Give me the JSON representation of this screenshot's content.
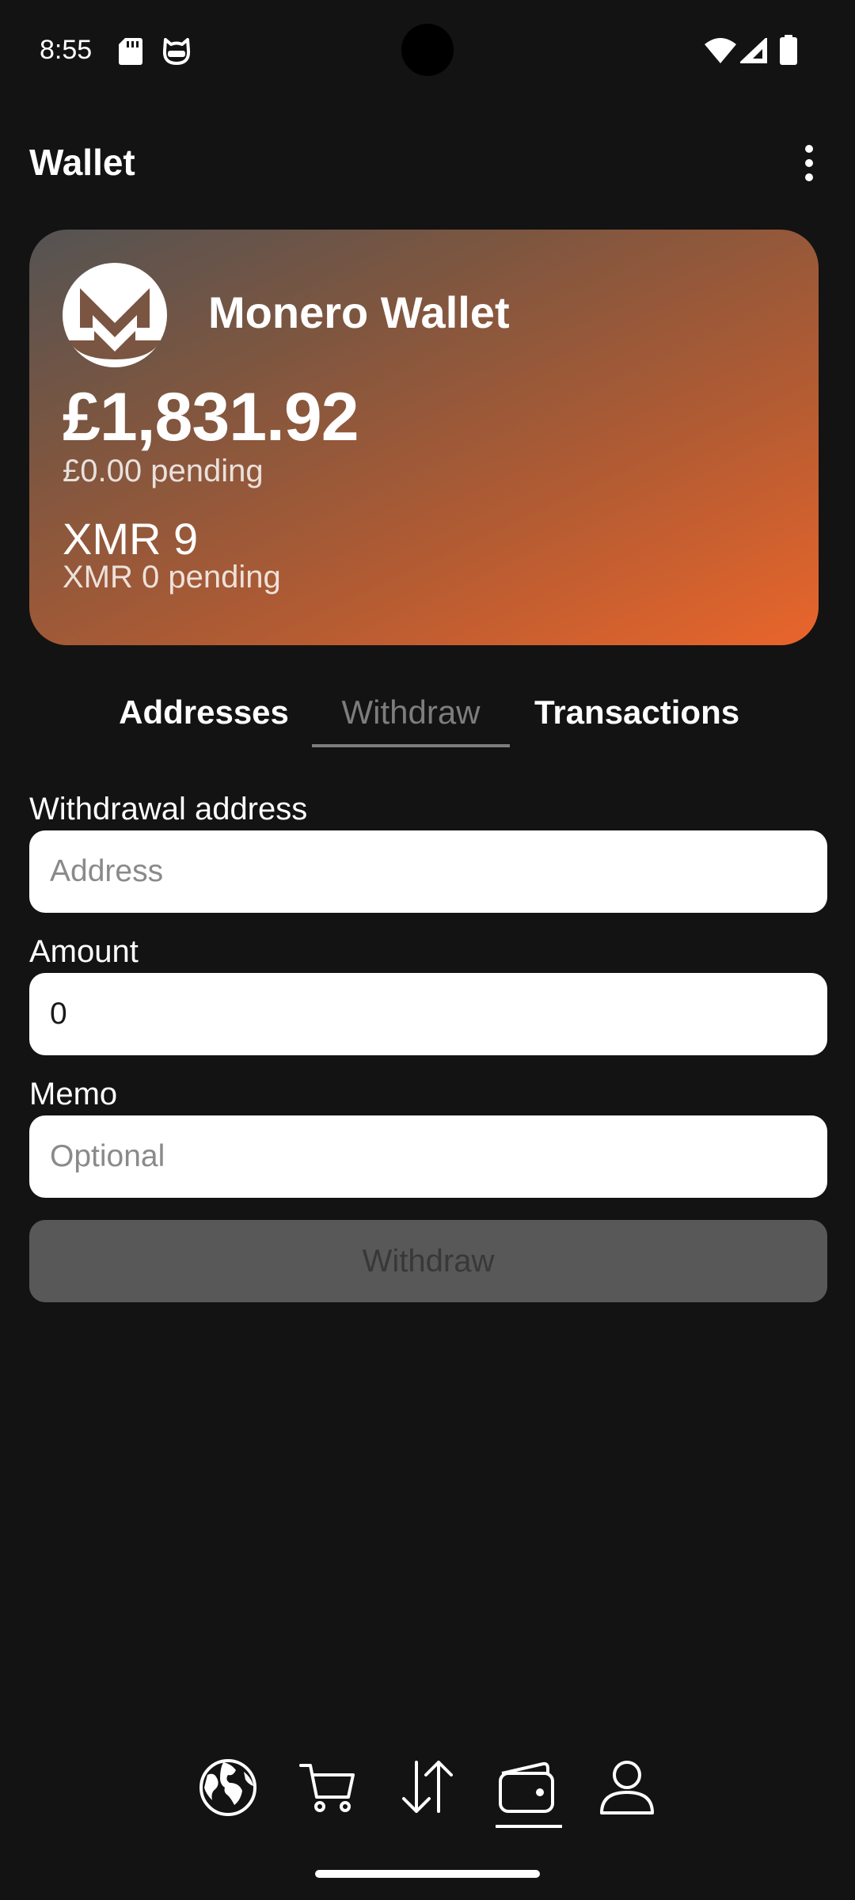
{
  "status_bar": {
    "time": "8:55",
    "icons": [
      "sd-card-icon",
      "cat-icon",
      "wifi-icon",
      "cell-signal-icon",
      "battery-icon"
    ]
  },
  "app_bar": {
    "title": "Wallet",
    "menu_icon": "more-vertical-icon"
  },
  "wallet_card": {
    "logo_icon": "monero-logo-icon",
    "name": "Monero Wallet",
    "fiat_balance": "£1,831.92",
    "fiat_pending": "£0.00 pending",
    "crypto_balance": "XMR 9",
    "crypto_pending": "XMR 0 pending",
    "gradient_colors": [
      "#545353",
      "#e9652b"
    ]
  },
  "tabs": [
    {
      "label": "Addresses",
      "active": false
    },
    {
      "label": "Withdraw",
      "active": true
    },
    {
      "label": "Transactions",
      "active": false
    }
  ],
  "form": {
    "address": {
      "label": "Withdrawal address",
      "value": "",
      "placeholder": "Address"
    },
    "amount": {
      "label": "Amount",
      "value": "0",
      "placeholder": ""
    },
    "memo": {
      "label": "Memo",
      "value": "",
      "placeholder": "Optional"
    },
    "submit_label": "Withdraw",
    "submit_enabled": false
  },
  "bottom_nav": {
    "items": [
      {
        "icon": "globe-icon",
        "active": false
      },
      {
        "icon": "shopping-cart-icon",
        "active": false
      },
      {
        "icon": "arrows-up-down-icon",
        "active": false
      },
      {
        "icon": "wallet-icon",
        "active": true
      },
      {
        "icon": "person-icon",
        "active": false
      }
    ]
  },
  "colors": {
    "background": "#131313",
    "inactive_tab": "#7d7d7d",
    "disabled_button": "#585858",
    "accent_orange": "#e9652b"
  }
}
